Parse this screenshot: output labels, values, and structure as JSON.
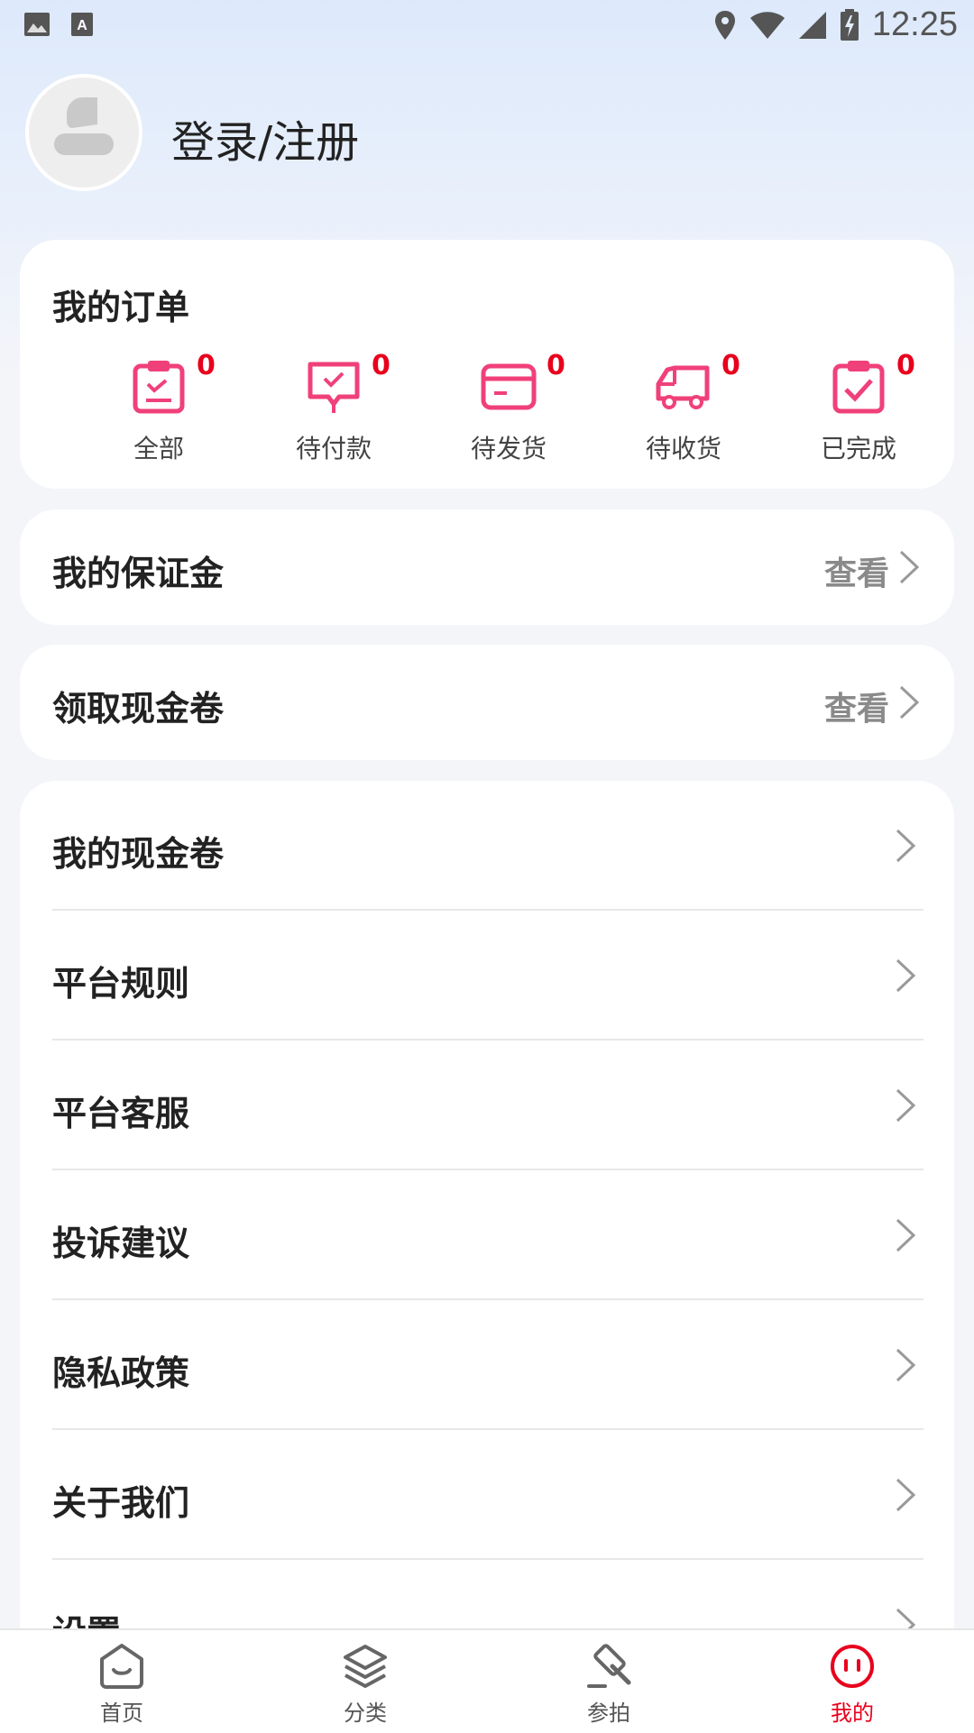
{
  "status_bar": {
    "time": "12:25",
    "icons": [
      "image-icon",
      "a-icon",
      "location-icon",
      "wifi-icon",
      "signal-icon",
      "battery-charging-icon"
    ]
  },
  "profile": {
    "login_text": "登录/注册"
  },
  "orders": {
    "title": "我的订单",
    "items": [
      {
        "label": "全部",
        "count": "0",
        "icon": "clipboard-list-icon"
      },
      {
        "label": "待付款",
        "count": "0",
        "icon": "payment-icon"
      },
      {
        "label": "待发货",
        "count": "0",
        "icon": "card-icon"
      },
      {
        "label": "待收货",
        "count": "0",
        "icon": "truck-icon"
      },
      {
        "label": "已完成",
        "count": "0",
        "icon": "clipboard-check-icon"
      }
    ]
  },
  "deposit": {
    "title": "我的保证金",
    "action": "查看"
  },
  "coupon_claim": {
    "title": "领取现金卷",
    "action": "查看"
  },
  "menu": {
    "items": [
      {
        "label": "我的现金卷"
      },
      {
        "label": "平台规则"
      },
      {
        "label": "平台客服"
      },
      {
        "label": "投诉建议"
      },
      {
        "label": "隐私政策"
      },
      {
        "label": "关于我们"
      },
      {
        "label": "设置"
      }
    ]
  },
  "bottom_nav": {
    "items": [
      {
        "label": "首页",
        "icon": "home-face-icon",
        "active": false
      },
      {
        "label": "分类",
        "icon": "layers-icon",
        "active": false
      },
      {
        "label": "参拍",
        "icon": "gavel-icon",
        "active": false
      },
      {
        "label": "我的",
        "icon": "profile-face-icon",
        "active": true
      }
    ]
  },
  "colors": {
    "accent": "#e8001c",
    "icon_pink": "#f0407a",
    "header_gradient_top": "#dde9fb"
  }
}
